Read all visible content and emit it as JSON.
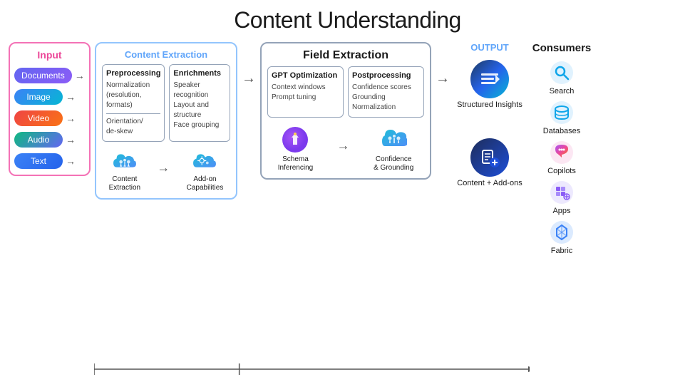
{
  "title": "Content Understanding",
  "input": {
    "label": "Input",
    "items": [
      {
        "label": "Documents",
        "badge_class": "badge-documents"
      },
      {
        "label": "Image",
        "badge_class": "badge-image"
      },
      {
        "label": "Video",
        "badge_class": "badge-video"
      },
      {
        "label": "Audio",
        "badge_class": "badge-audio"
      },
      {
        "label": "Text",
        "badge_class": "badge-text"
      }
    ]
  },
  "content_extraction": {
    "label": "Content Extraction",
    "preprocessing": {
      "title": "Preprocessing",
      "items": [
        "Normalization (resolution, formats)",
        "Orientation/ de-skew"
      ]
    },
    "enrichments": {
      "title": "Enrichments",
      "items": [
        "Speaker recognition",
        "Layout and structure",
        "Face grouping"
      ]
    },
    "icon1_label": "Content\nExtraction",
    "icon2_label": "Add-on\nCapabilities"
  },
  "field_extraction": {
    "label": "Field Extraction",
    "gpt_optimization": {
      "title": "GPT Optimization",
      "items": [
        "Context windows",
        "Prompt tuning"
      ]
    },
    "postprocessing": {
      "title": "Postprocessing",
      "items": [
        "Confidence scores",
        "Grounding",
        "Normalization"
      ]
    },
    "icon1_label": "Schema\nInferencing",
    "icon2_label": "Confidence\n& Grounding"
  },
  "output": {
    "label": "OUTPUT",
    "structured_insights": {
      "label": "Structured\nInsights"
    },
    "content_addons": {
      "label": "Content +\nAdd-ons"
    }
  },
  "consumers": {
    "title": "Consumers",
    "items": [
      {
        "label": "Search",
        "icon": "search"
      },
      {
        "label": "Databases",
        "icon": "databases"
      },
      {
        "label": "Copilots",
        "icon": "copilots"
      },
      {
        "label": "Apps",
        "icon": "apps"
      },
      {
        "label": "Fabric",
        "icon": "fabric"
      }
    ]
  }
}
